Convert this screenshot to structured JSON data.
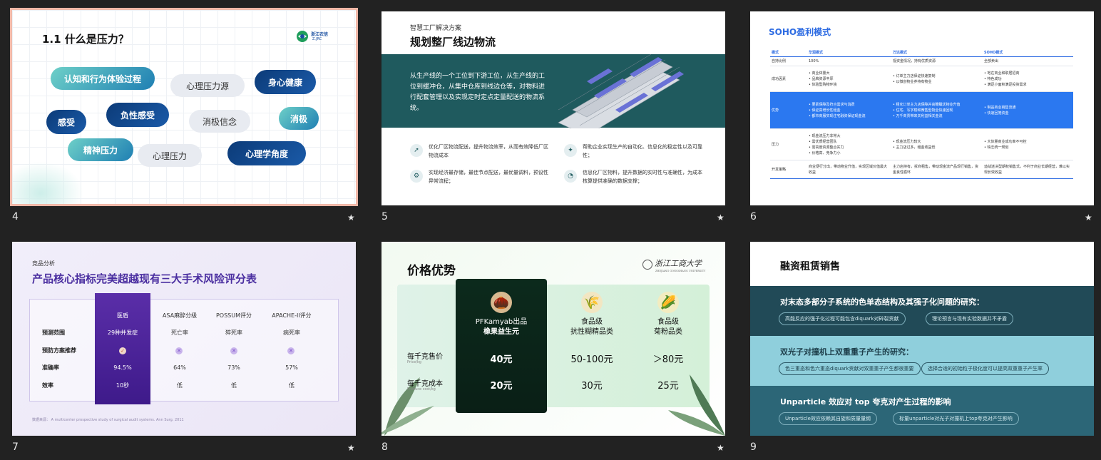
{
  "slides": [
    {
      "number": "4",
      "star": "★"
    },
    {
      "number": "5",
      "star": "★"
    },
    {
      "number": "6",
      "star": "★"
    },
    {
      "number": "7",
      "star": "★"
    },
    {
      "number": "8",
      "star": "★"
    },
    {
      "number": "9"
    }
  ],
  "s4": {
    "title_num": "1.1 ",
    "title": "什么是压力？",
    "logo_text": "浙江农信",
    "logo_sub": "Z.JRC",
    "pills": [
      "认知和行为体验过程",
      "心理压力源",
      "身心健康",
      "感受",
      "负性感受",
      "消极信念",
      "消极",
      "精神压力",
      "心理压力",
      "心理学角度"
    ]
  },
  "s5": {
    "subtitle": "智慧工厂解决方案",
    "title": "规划整厂线边物流",
    "band_text": "从生产线的一个工位到下游工位，从生产线的工位到缓冲仓，从集中仓库到线边仓等，对物料进行配套管理以及实现定时定点定量配送的物流系统。",
    "features": [
      "优化厂区物流配送，提升物流效率，从而有效降低厂区物流成本",
      "帮助企业实现生产的自动化、信息化的稳定性以及可靠性；",
      "实现经济最存储，最佳节点配送，最优量调料，预设性异常流程；",
      "信息化厂区物料，提升数据的实时性与准确性，为成本核算提供准确的数据支撑；"
    ],
    "icons": [
      "rocket-icon",
      "network-icon",
      "robot-icon",
      "pie-icon"
    ]
  },
  "s6": {
    "title": "SOHO盈利模式",
    "headers": [
      "模式",
      "华润模式",
      "万达模式",
      "SOHO模式"
    ],
    "rows": [
      {
        "label": "自持比例",
        "c1": "100%",
        "c2": "视资金情况，持有优质资源",
        "c3": "全部卖出"
      },
      {
        "label": "成功因素",
        "c1": "• 商业体量大\n• 品牌资源丰厚\n• 体验型购物环境",
        "c2": "• 订单主力店保证快速复制\n• 以微创物业养持有物业",
        "c3": "• 地在商业和职居招商\n• 特色成功\n• 满足小面积满足投资需求"
      },
      {
        "label": "优势",
        "c1": "• 要素保障及符合需求与消费\n• 保证高增长性租金\n• 都市商服实现住宅融资保证现金流",
        "c2": "• 租化订单主力店保障并高瞻瞩优物业升值\n• 住宅、写字楼和微售型物业快速回现\n• 万千商贾带来关利益相关金流",
        "c3": "• 制品商业销售流通\n• 快速回笼资金"
      },
      {
        "label": "压力",
        "c1": "• 现金流压力非常大\n• 需优质经营团队\n• 需高度资源整合实力\n• 价格高、竞争力小",
        "c2": "• 现金流压力较大\n• 主力店过多，租金收益低",
        "c3": "• 大体量商业成功率不可控\n• 缺乏统一规划"
      },
      {
        "label": "开发策略",
        "c1": "商业便行分出，带动物业升值，实现区域价值最大收益",
        "c2": "主力店持有，拆商租售，带动现金流产品现行销售，资金良性循环",
        "c3": "迪战迷决型期权销售式，不利于商业长期经营，难以实现长效收益"
      }
    ]
  },
  "s7": {
    "subtitle": "竞品分析",
    "title": "产品核心指标完美超越现有三大手术风险评分表",
    "col_headers": [
      "医盾",
      "ASA麻醉分级",
      "POSSUM评分",
      "APACHE-II评分"
    ],
    "row_labels": [
      "预测范围",
      "预防方案推荐",
      "准确率",
      "效率"
    ],
    "rows": [
      [
        "29种并发症",
        "死亡率",
        "猝死率",
        "病死率"
      ],
      [
        "✓",
        "✕",
        "✕",
        "✕"
      ],
      [
        "94.5%",
        "64%",
        "73%",
        "57%"
      ],
      [
        "10秒",
        "低",
        "低",
        "低"
      ]
    ],
    "source": "数据来源： A multicenter prospective study of surgical audit systems. Ann Surg. 2011"
  },
  "s8": {
    "title": "价格优势",
    "logo_text": "浙江工商大学",
    "logo_sub": "ZHEJIANG GONGSHANG UNIVERSITY",
    "row1_label": "每千克售价",
    "row1_sub": "Price/kg",
    "row2_label": "每千克成本",
    "row2_sub": "Produce cost/kg",
    "cols": [
      {
        "h1": "PFKamyab出品",
        "h2": "橡果益生元",
        "price": "40元",
        "cost": "20元",
        "icon": "acorn-icon"
      },
      {
        "h1": "食品级",
        "h2": "抗性糊精品类",
        "price": "50-100元",
        "cost": "30元",
        "icon": "wheat-icon"
      },
      {
        "h1": "食品级",
        "h2": "菊粉品类",
        "price": "＞80元",
        "cost": "25元",
        "icon": "corn-icon"
      }
    ]
  },
  "s9": {
    "title": "融资租赁销售",
    "sections": [
      {
        "heading": "对末态多部分子系统的色单态结构及其强子化问题的研究：",
        "tags": [
          "高能反应的强子化过程可能包含diquark对碎裂贡献",
          "理论预言与现有实验数据并不矛盾"
        ],
        "bg": "#214a57",
        "fg": "#ffffff"
      },
      {
        "heading": "双光子对撞机上双重重子产生的研究：",
        "tags": [
          "色三重态和色六重态diquark贡献对双重重子产生都很重要",
          "选择合适的初始粒子极化度可以提高双重重子产生率"
        ],
        "bg": "#8fcfdc",
        "fg": "#1d3e4a"
      },
      {
        "heading": "Unparticle 效应对 top 夸克对产生过程的影响",
        "tags": [
          "Unparticle效应依赖其自旋和质量量纲",
          "标量unparticle对光子对撞机上top夸克对产生影响"
        ],
        "bg": "#2c6677",
        "fg": "#ffffff"
      }
    ]
  }
}
